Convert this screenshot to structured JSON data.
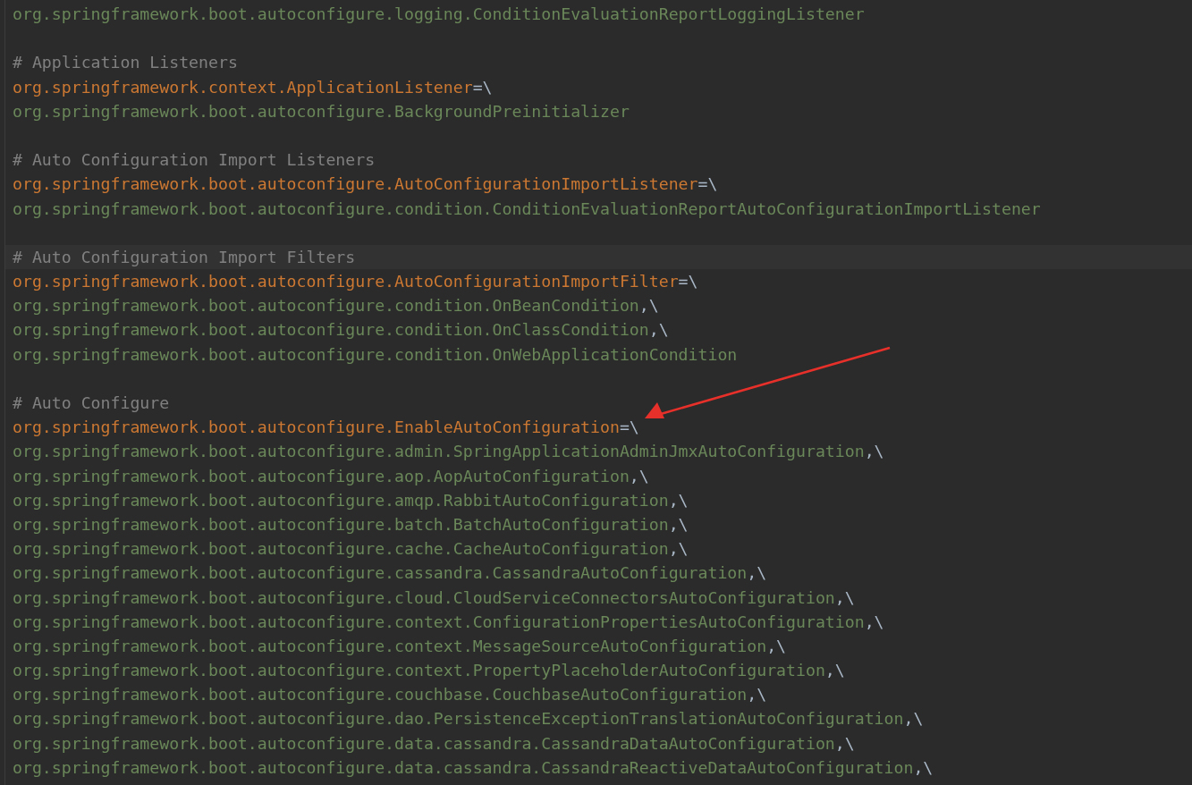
{
  "editor": {
    "sections": [
      {
        "lines": [
          {
            "kind": "value",
            "text": "org.springframework.boot.autoconfigure.logging.ConditionEvaluationReportLoggingListener",
            "current": false
          }
        ]
      },
      {
        "lines": [
          {
            "kind": "comment",
            "text": "# Application Listeners",
            "current": false
          },
          {
            "kind": "key",
            "text": "org.springframework.context.ApplicationListener",
            "suffix": "=\\",
            "current": false
          },
          {
            "kind": "value",
            "text": "org.springframework.boot.autoconfigure.BackgroundPreinitializer",
            "current": false
          }
        ]
      },
      {
        "lines": [
          {
            "kind": "comment",
            "text": "# Auto Configuration Import Listeners",
            "current": false
          },
          {
            "kind": "key",
            "text": "org.springframework.boot.autoconfigure.AutoConfigurationImportListener",
            "suffix": "=\\",
            "current": false
          },
          {
            "kind": "value",
            "text": "org.springframework.boot.autoconfigure.condition.ConditionEvaluationReportAutoConfigurationImportListener",
            "current": false
          }
        ]
      },
      {
        "lines": [
          {
            "kind": "comment",
            "text": "# Auto Configuration Import Filters",
            "current": true
          },
          {
            "kind": "key",
            "text": "org.springframework.boot.autoconfigure.AutoConfigurationImportFilter",
            "suffix": "=\\",
            "current": false
          },
          {
            "kind": "value",
            "text": "org.springframework.boot.autoconfigure.condition.OnBeanCondition",
            "suffix": ",\\",
            "current": false
          },
          {
            "kind": "value",
            "text": "org.springframework.boot.autoconfigure.condition.OnClassCondition",
            "suffix": ",\\",
            "current": false
          },
          {
            "kind": "value",
            "text": "org.springframework.boot.autoconfigure.condition.OnWebApplicationCondition",
            "current": false
          }
        ]
      },
      {
        "lines": [
          {
            "kind": "comment",
            "text": "# Auto Configure",
            "current": false
          },
          {
            "kind": "key",
            "text": "org.springframework.boot.autoconfigure.EnableAutoConfiguration",
            "suffix": "=\\",
            "current": false,
            "arrow": true
          },
          {
            "kind": "value",
            "text": "org.springframework.boot.autoconfigure.admin.SpringApplicationAdminJmxAutoConfiguration",
            "suffix": ",\\",
            "current": false
          },
          {
            "kind": "value",
            "text": "org.springframework.boot.autoconfigure.aop.AopAutoConfiguration",
            "suffix": ",\\",
            "current": false
          },
          {
            "kind": "value",
            "text": "org.springframework.boot.autoconfigure.amqp.RabbitAutoConfiguration",
            "suffix": ",\\",
            "current": false
          },
          {
            "kind": "value",
            "text": "org.springframework.boot.autoconfigure.batch.BatchAutoConfiguration",
            "suffix": ",\\",
            "current": false
          },
          {
            "kind": "value",
            "text": "org.springframework.boot.autoconfigure.cache.CacheAutoConfiguration",
            "suffix": ",\\",
            "current": false
          },
          {
            "kind": "value",
            "text": "org.springframework.boot.autoconfigure.cassandra.CassandraAutoConfiguration",
            "suffix": ",\\",
            "current": false
          },
          {
            "kind": "value",
            "text": "org.springframework.boot.autoconfigure.cloud.CloudServiceConnectorsAutoConfiguration",
            "suffix": ",\\",
            "current": false
          },
          {
            "kind": "value",
            "text": "org.springframework.boot.autoconfigure.context.ConfigurationPropertiesAutoConfiguration",
            "suffix": ",\\",
            "current": false
          },
          {
            "kind": "value",
            "text": "org.springframework.boot.autoconfigure.context.MessageSourceAutoConfiguration",
            "suffix": ",\\",
            "current": false
          },
          {
            "kind": "value",
            "text": "org.springframework.boot.autoconfigure.context.PropertyPlaceholderAutoConfiguration",
            "suffix": ",\\",
            "current": false
          },
          {
            "kind": "value",
            "text": "org.springframework.boot.autoconfigure.couchbase.CouchbaseAutoConfiguration",
            "suffix": ",\\",
            "current": false
          },
          {
            "kind": "value",
            "text": "org.springframework.boot.autoconfigure.dao.PersistenceExceptionTranslationAutoConfiguration",
            "suffix": ",\\",
            "current": false
          },
          {
            "kind": "value",
            "text": "org.springframework.boot.autoconfigure.data.cassandra.CassandraDataAutoConfiguration",
            "suffix": ",\\",
            "current": false
          },
          {
            "kind": "value",
            "text": "org.springframework.boot.autoconfigure.data.cassandra.CassandraReactiveDataAutoConfiguration",
            "suffix": ",\\",
            "current": false
          }
        ]
      }
    ]
  }
}
